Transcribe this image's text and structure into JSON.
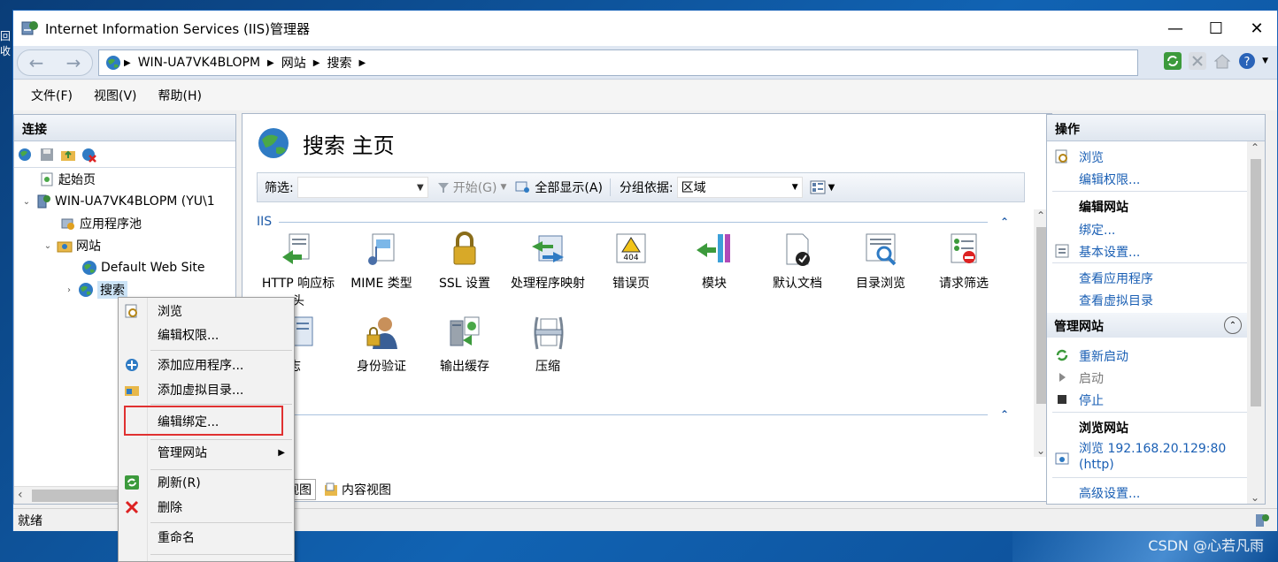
{
  "window": {
    "title": "Internet Information Services (IIS)管理器",
    "controls": {
      "minimize": "—",
      "maximize": "☐",
      "close": "✕"
    }
  },
  "desktop": {
    "side_label": "回收",
    "watermark": "CSDN @心若凡雨"
  },
  "address": {
    "crumbs": [
      "WIN-UA7VK4BLOPM",
      "网站",
      "搜索"
    ]
  },
  "menu": [
    "文件(F)",
    "视图(V)",
    "帮助(H)"
  ],
  "connections": {
    "header": "连接",
    "tree": [
      {
        "label": "起始页",
        "level": 1,
        "expander": "",
        "icon": "start-page-icon"
      },
      {
        "label": "WIN-UA7VK4BLOPM (YU\\1",
        "level": 1,
        "expander": "⌄",
        "icon": "server-icon"
      },
      {
        "label": "应用程序池",
        "level": 2,
        "expander": "",
        "icon": "app-pool-icon"
      },
      {
        "label": "网站",
        "level": 2,
        "expander": "⌄",
        "icon": "sites-folder-icon"
      },
      {
        "label": "Default Web Site",
        "level": 3,
        "expander": "",
        "icon": "globe-icon"
      },
      {
        "label": "搜索",
        "level": 3,
        "expander": "›",
        "icon": "globe-icon",
        "selected": true
      }
    ]
  },
  "center": {
    "title": "搜索 主页",
    "filter": {
      "label": "筛选:",
      "start": "开始(G)",
      "show_all": "全部显示(A)",
      "group_by": "分组依据:",
      "group_value": "区域"
    },
    "section": "IIS",
    "features": [
      {
        "label": "HTTP 响应标头",
        "icon": "http-response-icon"
      },
      {
        "label": "MIME 类型",
        "icon": "mime-icon"
      },
      {
        "label": "SSL 设置",
        "icon": "lock-icon"
      },
      {
        "label": "处理程序映射",
        "icon": "handler-icon"
      },
      {
        "label": "错误页",
        "icon": "error-page-icon"
      },
      {
        "label": "模块",
        "icon": "modules-icon"
      },
      {
        "label": "默认文档",
        "icon": "default-doc-icon"
      },
      {
        "label": "目录浏览",
        "icon": "dir-browse-icon"
      },
      {
        "label": "请求筛选",
        "icon": "request-filter-icon"
      },
      {
        "label": "日志",
        "icon": "log-icon"
      },
      {
        "label": "身份验证",
        "icon": "auth-icon"
      },
      {
        "label": "输出缓存",
        "icon": "output-cache-icon"
      },
      {
        "label": "压缩",
        "icon": "compress-icon"
      }
    ],
    "view_tabs": [
      "功能视图",
      "内容视图"
    ]
  },
  "actions": {
    "header": "操作",
    "browse": "浏览",
    "edit_perms": "编辑权限...",
    "edit_site_head": "编辑网站",
    "bindings": "绑定...",
    "basic_settings": "基本设置...",
    "view_apps": "查看应用程序",
    "view_vdirs": "查看虚拟目录",
    "manage_head": "管理网站",
    "restart": "重新启动",
    "start": "启动",
    "stop": "停止",
    "browse_head": "浏览网站",
    "browse_url": "浏览 192.168.20.129:80",
    "browse_proto": "(http)",
    "advanced": "高级设置..."
  },
  "status": {
    "text": "就绪"
  },
  "context_menu": [
    {
      "label": "浏览",
      "icon": "browse-icon"
    },
    {
      "label": "编辑权限...",
      "icon": ""
    },
    {
      "label": "添加应用程序...",
      "icon": "add-app-icon"
    },
    {
      "label": "添加虚拟目录...",
      "icon": "add-vdir-icon"
    },
    {
      "label": "编辑绑定...",
      "icon": ""
    },
    {
      "label": "管理网站",
      "icon": "",
      "submenu": "▶"
    },
    {
      "label": "刷新(R)",
      "icon": "refresh-icon"
    },
    {
      "label": "删除",
      "icon": "delete-icon"
    },
    {
      "label": "重命名",
      "icon": ""
    }
  ]
}
